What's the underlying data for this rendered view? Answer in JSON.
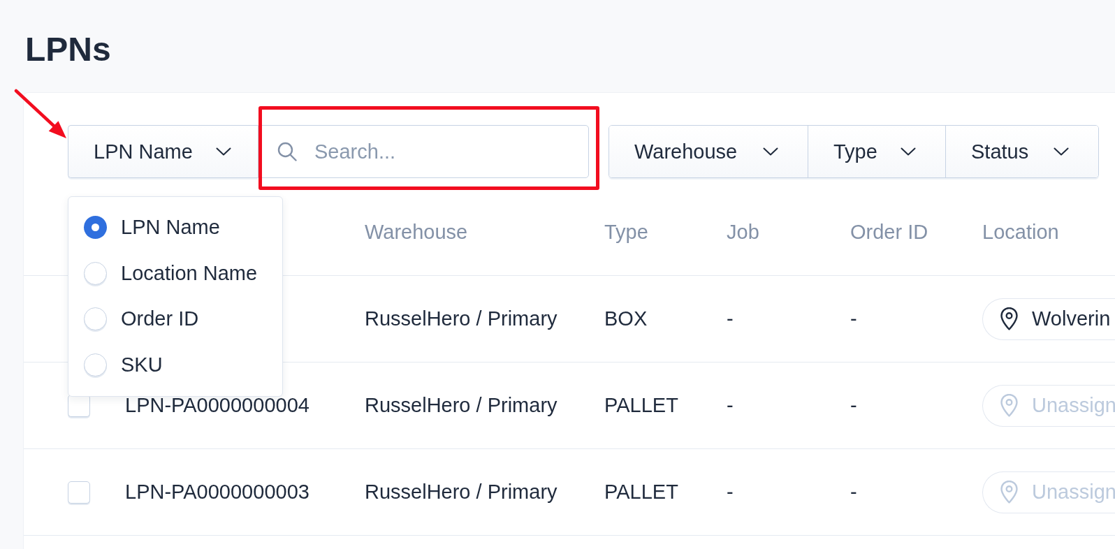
{
  "page": {
    "title": "LPNs"
  },
  "filters": {
    "search_by": {
      "label": "LPN Name",
      "expanded": true
    },
    "search": {
      "placeholder": "Search..."
    },
    "dropdowns": [
      {
        "label": "Warehouse"
      },
      {
        "label": "Type"
      },
      {
        "label": "Status"
      }
    ]
  },
  "search_by_menu": {
    "options": [
      {
        "label": "LPN Name",
        "selected": true
      },
      {
        "label": "Location Name",
        "selected": false
      },
      {
        "label": "Order ID",
        "selected": false
      },
      {
        "label": "SKU",
        "selected": false
      }
    ]
  },
  "table": {
    "columns": [
      "Warehouse",
      "Type",
      "Job",
      "Order ID",
      "Location"
    ],
    "rows": [
      {
        "warehouse": "RusselHero / Primary",
        "type": "BOX",
        "job": "-",
        "order_id": "-",
        "location": {
          "label": "Wolverin",
          "assigned": true
        }
      },
      {
        "checked": false,
        "lpn": "LPN-PA0000000004",
        "warehouse": "RusselHero / Primary",
        "type": "PALLET",
        "job": "-",
        "order_id": "-",
        "location": {
          "label": "Unassign",
          "assigned": false
        }
      },
      {
        "checked": false,
        "lpn": "LPN-PA0000000003",
        "warehouse": "RusselHero / Primary",
        "type": "PALLET",
        "job": "-",
        "order_id": "-",
        "location": {
          "label": "Unassign",
          "assigned": false
        }
      }
    ]
  },
  "annotations": {
    "arrow": true,
    "highlight_box": true
  }
}
